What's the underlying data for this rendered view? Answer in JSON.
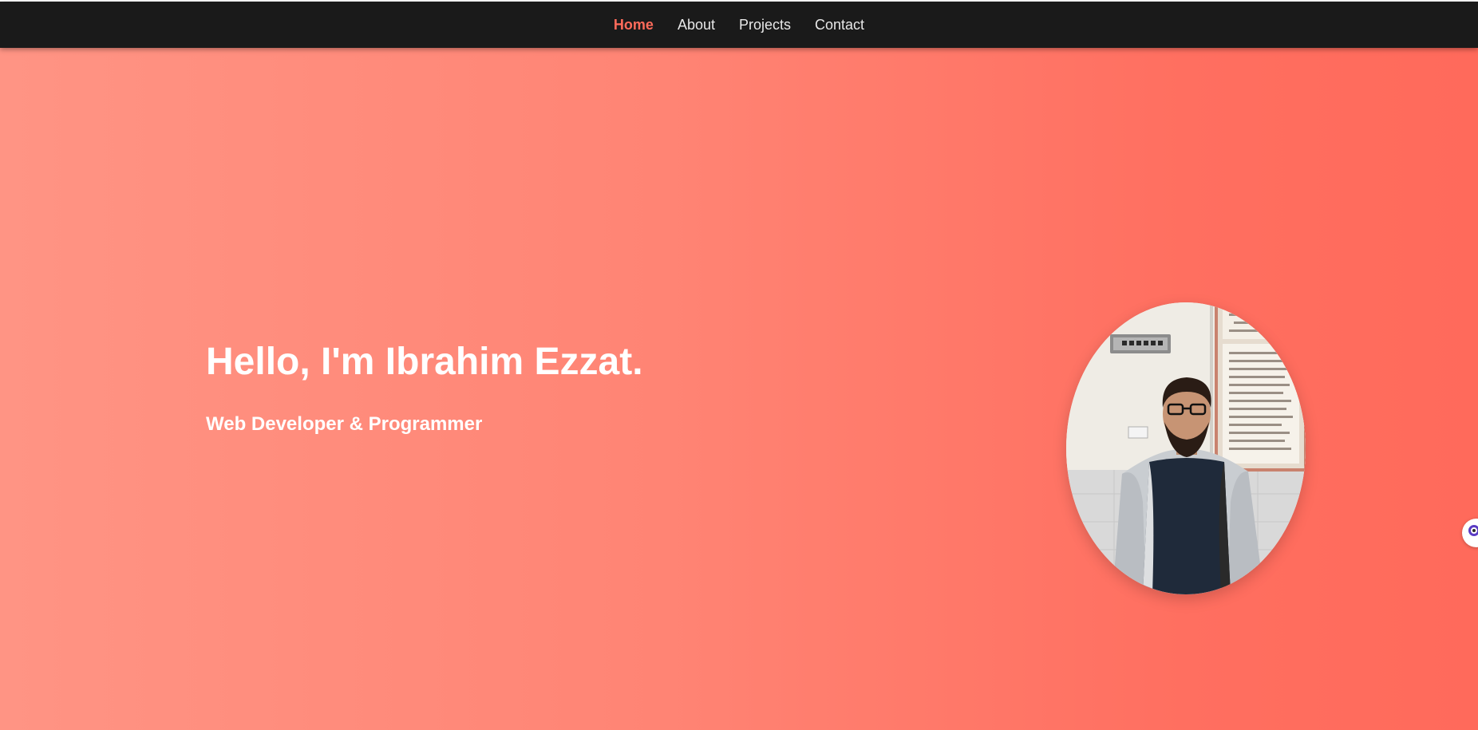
{
  "nav": {
    "items": [
      {
        "label": "Home",
        "active": true
      },
      {
        "label": "About",
        "active": false
      },
      {
        "label": "Projects",
        "active": false
      },
      {
        "label": "Contact",
        "active": false
      }
    ]
  },
  "hero": {
    "title": "Hello, I'm Ibrahim Ezzat.",
    "subtitle": "Web Developer & Programmer"
  },
  "colors": {
    "navbar_bg": "#1a1a1a",
    "nav_active": "#ff6b5a",
    "hero_gradient_start": "#ff9484",
    "hero_gradient_end": "#ff6a5b"
  },
  "icons": {
    "side_widget": "accessibility-widget-icon"
  }
}
